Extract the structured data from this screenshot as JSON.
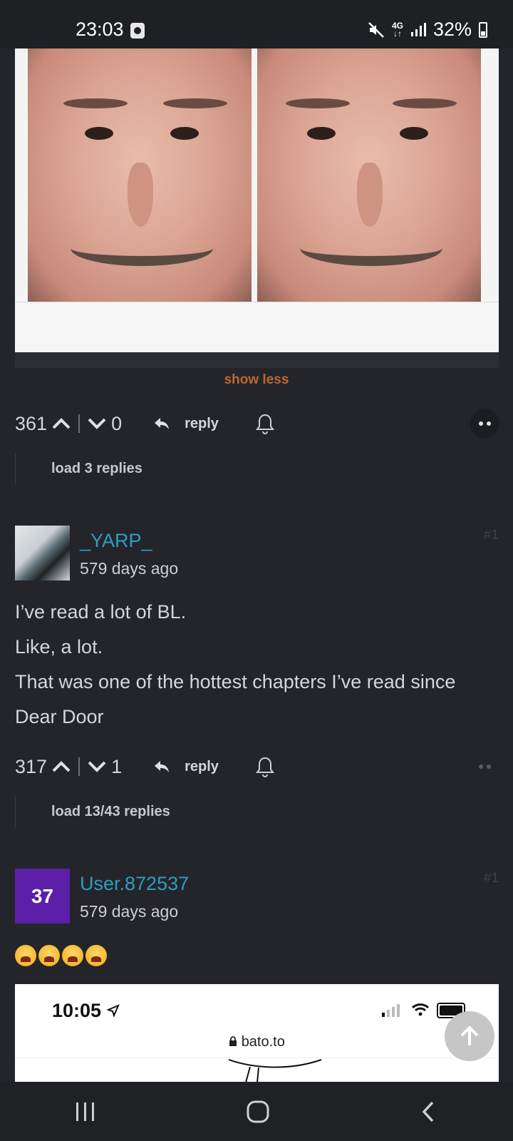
{
  "status_bar": {
    "time": "23:03",
    "network": "4G",
    "battery": "32%"
  },
  "post": {
    "show_less_label": "show less",
    "upvotes": "361",
    "downvotes": "0",
    "reply_label": "reply",
    "load_replies_label": "load 3 replies"
  },
  "comments": [
    {
      "username": "_YARP_",
      "time": "579 days ago",
      "index": "#1",
      "lines": [
        "I’ve read a lot of BL.",
        "Like, a lot.",
        "That was one of the hottest chapters I’ve read since",
        "Dear Door"
      ],
      "upvotes": "317",
      "downvotes": "1",
      "reply_label": "reply",
      "load_replies_label": "load 13/43 replies"
    },
    {
      "username": "User.872537",
      "avatar_text": "37",
      "time": "579 days ago",
      "index": "#1",
      "embed": {
        "time": "10:05",
        "url": "bato.to"
      }
    }
  ],
  "colors": {
    "background": "#23252b",
    "username": "#2f9cc0",
    "show_less": "#c0672e",
    "avatar_purple": "#5b1fa8"
  }
}
